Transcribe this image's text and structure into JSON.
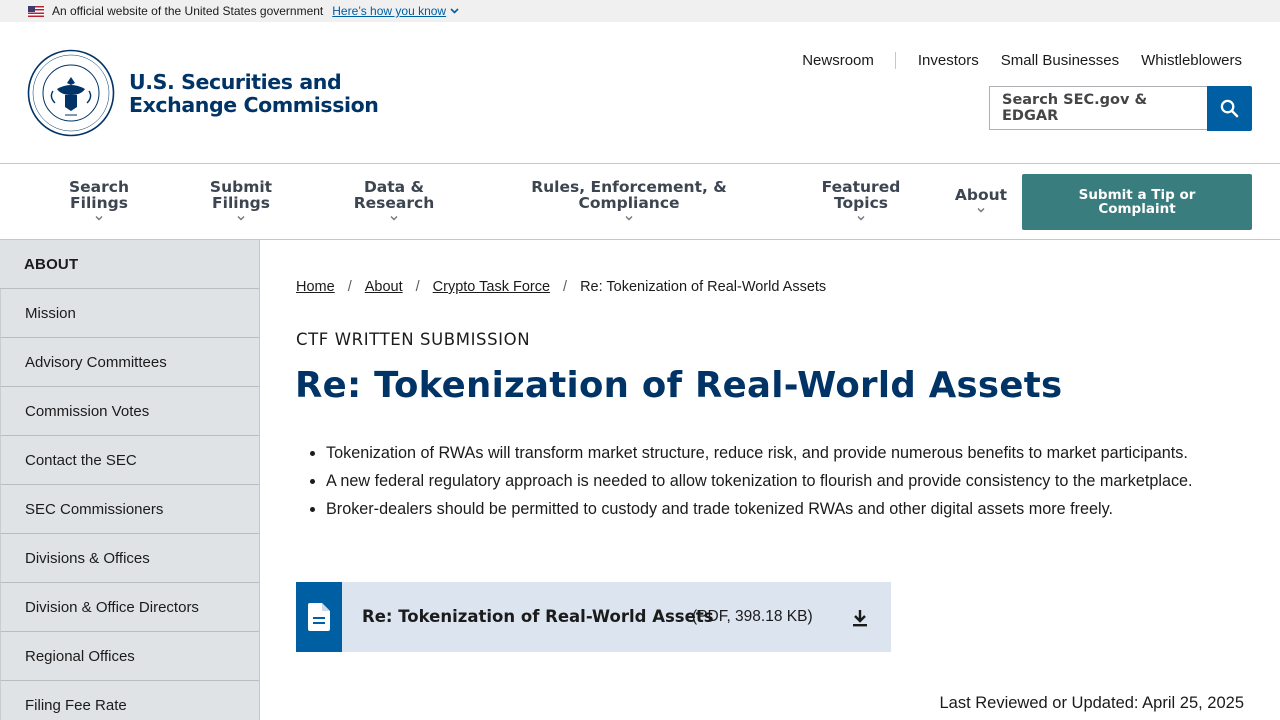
{
  "gov_banner": {
    "text": "An official website of the United States government",
    "link": "Here’s how you know"
  },
  "brand": {
    "line1": "U.S. Securities and",
    "line2": "Exchange Commission",
    "seal_text": [
      "SECURITIES AND EXCHANGE COMMISSION",
      "MCMXXXIV"
    ]
  },
  "utility_nav": [
    "Newsroom",
    "Investors",
    "Small Businesses",
    "Whistleblowers"
  ],
  "search": {
    "placeholder": "Search SEC.gov & EDGAR"
  },
  "main_nav": {
    "items": [
      {
        "line1": "Search",
        "line2": "Filings"
      },
      {
        "line1": "Submit",
        "line2": "Filings"
      },
      {
        "line1": "Data &",
        "line2": "Research"
      },
      {
        "line1": "Rules, Enforcement, &",
        "line2": "Compliance"
      },
      {
        "line1": "Featured",
        "line2": "Topics"
      },
      {
        "line1": "About",
        "line2": ""
      }
    ],
    "tip_button": {
      "line1": "Submit a Tip or",
      "line2": "Complaint"
    }
  },
  "sidebar": {
    "heading": "ABOUT",
    "items": [
      "Mission",
      "Advisory Committees",
      "Commission Votes",
      "Contact the SEC",
      "SEC Commissioners",
      "Divisions & Offices",
      "Division & Office Directors",
      "Regional Offices",
      "Filing Fee Rate"
    ]
  },
  "breadcrumb": {
    "links": [
      "Home",
      "About",
      "Crypto Task Force"
    ],
    "current": "Re: Tokenization of Real-World Assets"
  },
  "content": {
    "eyebrow": "CTF WRITTEN SUBMISSION",
    "title": "Re: Tokenization of Real-World Assets",
    "bullets": [
      "Tokenization of RWAs will transform market structure, reduce risk, and provide numerous benefits to market participants.",
      "A new federal regulatory approach is needed to allow tokenization to flourish and provide consistency to the marketplace.",
      "Broker-dealers should be permitted to custody and trade tokenized RWAs and other digital assets more freely."
    ],
    "download": {
      "title": "Re: Tokenization of Real-World Assets",
      "meta": "(PDF, 398.18 KB)"
    },
    "last_updated": "Last Reviewed or Updated: April 25, 2025"
  },
  "colors": {
    "brand_navy": "#003366",
    "link_blue": "#005ea2",
    "tip_teal": "#3a7d7e",
    "sidebar_bg": "#e0e3e6",
    "download_bg": "#dce4ef"
  }
}
